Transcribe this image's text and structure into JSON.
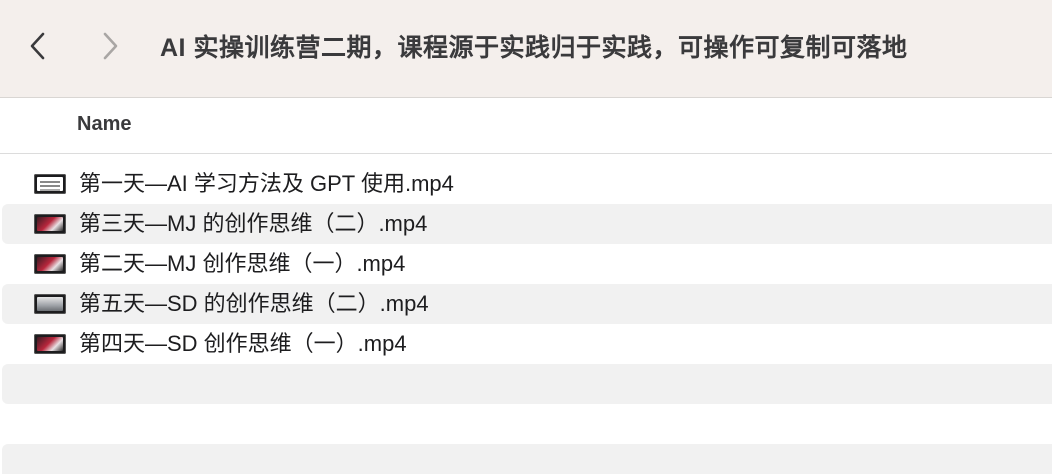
{
  "window": {
    "title": "AI 实操训练营二期，课程源于实践归于实践，可操作可复制可落地"
  },
  "toolbar": {
    "back_icon": "chevron-left-icon",
    "forward_icon": "chevron-right-icon"
  },
  "columns": {
    "name_header": "Name"
  },
  "files": [
    {
      "name": "第一天—AI 学习方法及 GPT 使用.mp4",
      "thumb": "doc"
    },
    {
      "name": "第三天—MJ 的创作思维（二）.mp4",
      "thumb": "red"
    },
    {
      "name": "第二天—MJ 创作思维（一）.mp4",
      "thumb": "red"
    },
    {
      "name": "第五天—SD 的创作思维（二）.mp4",
      "thumb": "gray"
    },
    {
      "name": "第四天—SD 创作思维（一）.mp4",
      "thumb": "red"
    }
  ],
  "colors": {
    "toolbar_bg": "#f4efec",
    "row_alt_bg": "#f1f1f1",
    "text": "#1d1d1f"
  }
}
